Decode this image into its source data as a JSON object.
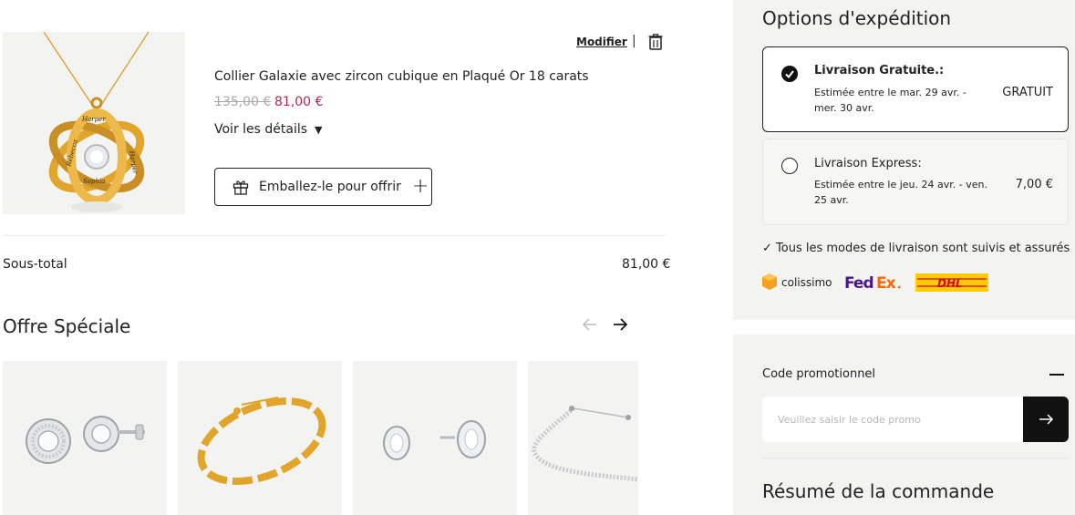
{
  "cart": {
    "modify_label": "Modifier",
    "separator": "|",
    "product_title": "Collier Galaxie avec zircon cubique en Plaqué Or 18 carats",
    "old_price": "135,00 €",
    "new_price": "81,00 €",
    "details_label": "Voir les détails",
    "gift_wrap_label": "Emballez-le pour offrir",
    "subtotal_label": "Sous-total",
    "subtotal_value": "81,00 €",
    "engravings": [
      "Harper",
      "Rebecca",
      "Sophia",
      "Harper"
    ]
  },
  "offer": {
    "title": "Offre Spéciale"
  },
  "shipping": {
    "title": "Options d'expédition",
    "options": [
      {
        "name": "Livraison Gratuite.:",
        "estimate": "Estimée entre le mar. 29 avr. - mer. 30 avr.",
        "price": "GRATUIT",
        "selected": true
      },
      {
        "name": "Livraison Express:",
        "estimate": "Estimée entre le jeu. 24 avr. - ven. 25 avr.",
        "price": "7,00 €",
        "selected": false
      }
    ],
    "tracked_note": "✓ Tous les modes de livraison sont suivis et assurés",
    "carriers": {
      "colissimo": "colissimo",
      "fedex_fed": "Fed",
      "fedex_ex": "Ex",
      "dhl": "DHL"
    }
  },
  "promo": {
    "label": "Code promotionnel",
    "placeholder": "Veuillez saisir le code promo"
  },
  "summary": {
    "title": "Résumé de la commande"
  },
  "colors": {
    "sale_price": "#b0284f",
    "panel_bg": "#f3f3f1",
    "fedex_purple": "#4d148c",
    "fedex_orange": "#ff6600",
    "dhl_yellow": "#ffcc00",
    "dhl_red": "#d40511",
    "gold": "#e0a52a"
  }
}
